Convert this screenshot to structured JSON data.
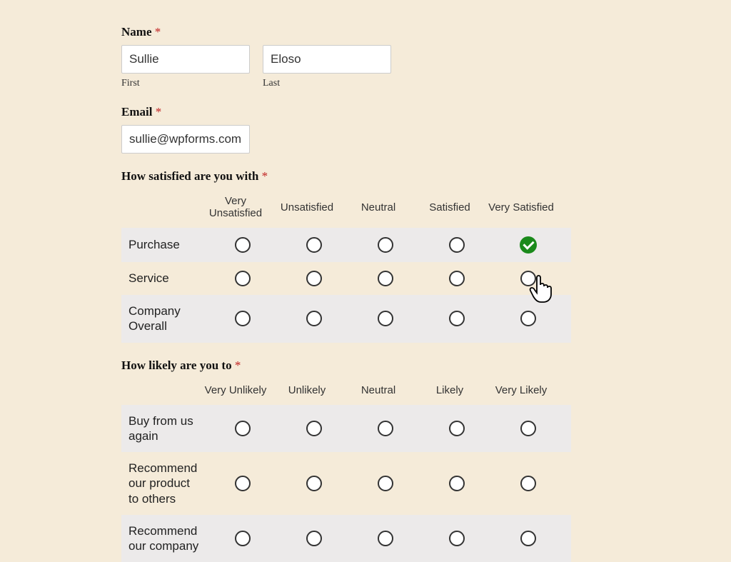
{
  "name": {
    "label": "Name",
    "first_value": "Sullie",
    "first_sub": "First",
    "last_value": "Eloso",
    "last_sub": "Last"
  },
  "email": {
    "label": "Email",
    "value": "sullie@wpforms.com"
  },
  "satisfaction": {
    "label": "How satisfied are you with",
    "columns": [
      "Very Unsatisfied",
      "Unsatisfied",
      "Neutral",
      "Satisfied",
      "Very Satisfied"
    ],
    "rows": [
      {
        "label": "Purchase",
        "selected": 4
      },
      {
        "label": "Service",
        "selected": null
      },
      {
        "label": "Company Overall",
        "selected": null
      }
    ]
  },
  "likelihood": {
    "label": "How likely are you to",
    "columns": [
      "Very Unlikely",
      "Unlikely",
      "Neutral",
      "Likely",
      "Very Likely"
    ],
    "rows": [
      {
        "label": "Buy from us again",
        "selected": null
      },
      {
        "label": "Recommend our product to others",
        "selected": null
      },
      {
        "label": "Recommend our company",
        "selected": null
      }
    ]
  }
}
